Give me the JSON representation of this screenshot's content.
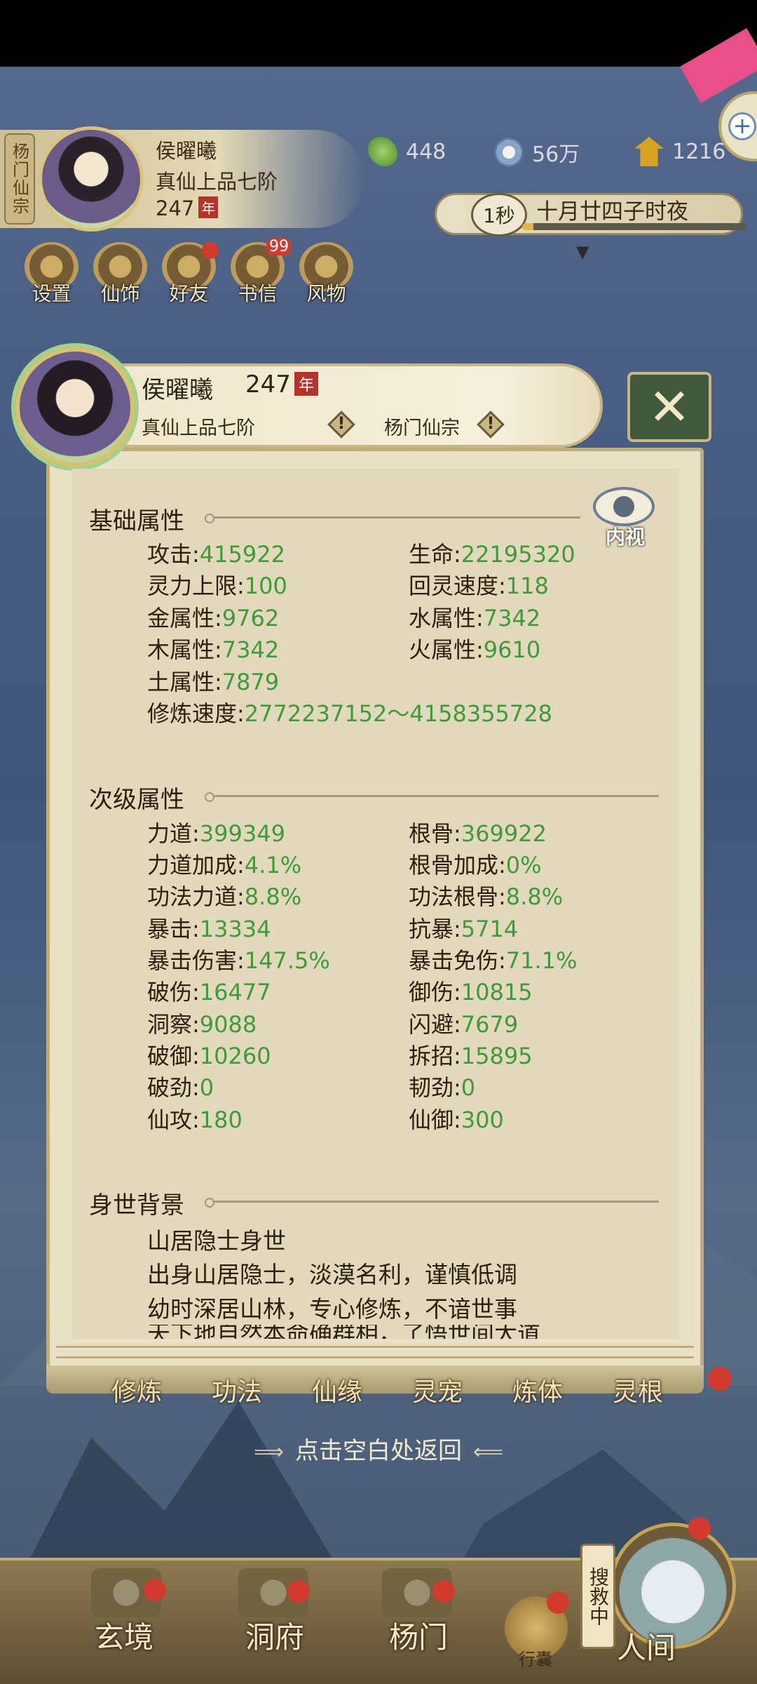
{
  "hud": {
    "sect_tag": "杨门仙宗",
    "player_name": "侯曜曦",
    "player_rank": "真仙上品七阶",
    "player_age": "247",
    "age_unit": "年",
    "resources": {
      "jade": "448",
      "coins": "56万",
      "gold": "1216"
    },
    "time_speed": "1秒",
    "date_text": "十月廿四子时夜",
    "time_progress": 0.05,
    "menu": [
      {
        "label": "设置"
      },
      {
        "label": "仙饰"
      },
      {
        "label": "好友"
      },
      {
        "label": "书信",
        "badge": "99"
      },
      {
        "label": "风物"
      }
    ]
  },
  "dialog": {
    "name": "侯曜曦",
    "age": "247",
    "age_unit": "年",
    "rank": "真仙上品七阶",
    "sect": "杨门仙宗",
    "info_icon_symbol": "!",
    "close_symbol": "✕",
    "inspect_label": "内视",
    "basic": {
      "title": "基础属性",
      "stats": [
        {
          "label": "攻击:",
          "value": "415922"
        },
        {
          "label": "生命:",
          "value": "22195320"
        },
        {
          "label": "灵力上限:",
          "value": "100"
        },
        {
          "label": "回灵速度:",
          "value": "118"
        },
        {
          "label": "金属性:",
          "value": "9762"
        },
        {
          "label": "水属性:",
          "value": "7342"
        },
        {
          "label": "木属性:",
          "value": "7342"
        },
        {
          "label": "火属性:",
          "value": "9610"
        },
        {
          "label": "土属性:",
          "value": "7879"
        },
        {
          "label": "修炼速度:",
          "value": "2772237152～4158355728"
        }
      ]
    },
    "secondary": {
      "title": "次级属性",
      "stats": [
        {
          "label": "力道:",
          "value": "399349"
        },
        {
          "label": "根骨:",
          "value": "369922"
        },
        {
          "label": "力道加成:",
          "value": "4.1%"
        },
        {
          "label": "根骨加成:",
          "value": "0%"
        },
        {
          "label": "功法力道:",
          "value": "8.8%"
        },
        {
          "label": "功法根骨:",
          "value": "8.8%"
        },
        {
          "label": "暴击:",
          "value": "13334"
        },
        {
          "label": "抗暴:",
          "value": "5714"
        },
        {
          "label": "暴击伤害:",
          "value": "147.5%"
        },
        {
          "label": "暴击免伤:",
          "value": "71.1%"
        },
        {
          "label": "破伤:",
          "value": "16477"
        },
        {
          "label": "御伤:",
          "value": "10815"
        },
        {
          "label": "洞察:",
          "value": "9088"
        },
        {
          "label": "闪避:",
          "value": "7679"
        },
        {
          "label": "破御:",
          "value": "10260"
        },
        {
          "label": "拆招:",
          "value": "15895"
        },
        {
          "label": "破劲:",
          "value": "0"
        },
        {
          "label": "韧劲:",
          "value": "0"
        },
        {
          "label": "仙攻:",
          "value": "180"
        },
        {
          "label": "仙御:",
          "value": "300"
        }
      ]
    },
    "background": {
      "title": "身世背景",
      "lines": [
        "山居隐士身世",
        "出身山居隐士，淡漠名利，谨慎低调",
        "幼时深居山林，专心修炼，不谙世事",
        "天下地自然本命确群相，了悟世间大道"
      ]
    }
  },
  "sub_tabs": [
    {
      "label": "修炼"
    },
    {
      "label": "功法"
    },
    {
      "label": "仙缘"
    },
    {
      "label": "灵宠"
    },
    {
      "label": "炼体"
    },
    {
      "label": "灵根"
    }
  ],
  "back_hint": "点击空白处返回",
  "nav": {
    "tabs": [
      {
        "label": "玄境"
      },
      {
        "label": "洞府"
      },
      {
        "label": "杨门"
      },
      {
        "label": "人间"
      }
    ],
    "search_tag": "搜救中",
    "bag_label": "行囊"
  },
  "colors": {
    "stat_value": "#3f9a3a",
    "badge_red": "#d23a2e",
    "panel_bg": "#e2d9bc"
  }
}
